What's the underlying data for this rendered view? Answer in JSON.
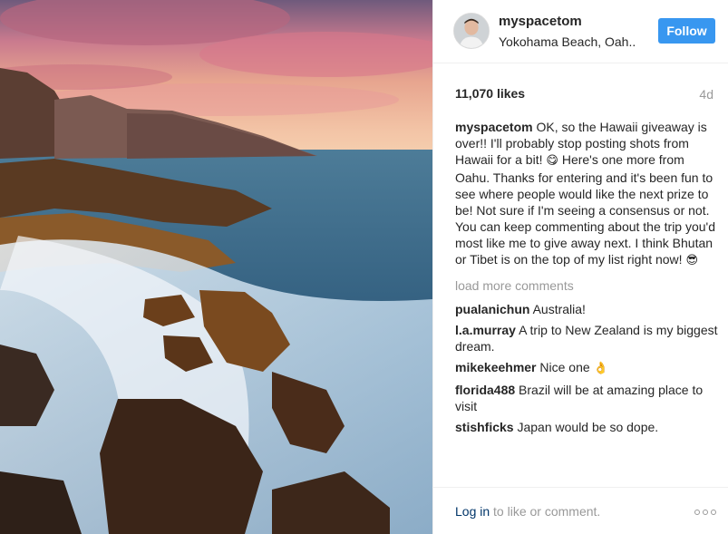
{
  "post": {
    "username": "myspacetom",
    "location": "Yokohama Beach, Oah..",
    "follow_label": "Follow",
    "likes": "11,070 likes",
    "age": "4d",
    "caption_user": "myspacetom",
    "caption_text_1": "OK, so the Hawaii giveaway is over!! I'll probably stop posting shots from Hawaii for a bit! ",
    "caption_emoji_1": "😋",
    "caption_text_2": " Here's one more from Oahu. Thanks for entering and it's been fun to see where people would like the next prize to be! Not sure if I'm seeing a consensus or not. You can keep commenting about the trip you'd most like me to give away next. I think Bhutan or Tibet is on the top of my list right now! ",
    "caption_emoji_2": "😎",
    "load_more": "load more comments",
    "comments": [
      {
        "user": "pualanichun",
        "text": "Australia!"
      },
      {
        "user": "l.a.murray",
        "text": "A trip to New Zealand is my biggest dream."
      },
      {
        "user": "mikekeehmer",
        "text": "Nice one ",
        "emoji": "👌"
      },
      {
        "user": "florida488",
        "text": "Brazil will be at amazing place to visit"
      },
      {
        "user": "stishficks",
        "text": "Japan would be so dope."
      }
    ],
    "login_link": "Log in",
    "login_rest": " to like or comment."
  },
  "icons": {
    "more": "more-options-icon",
    "avatar": "avatar"
  },
  "colors": {
    "follow_button": "#3897f0",
    "link": "#003569",
    "muted": "#999999",
    "text": "#262626"
  }
}
